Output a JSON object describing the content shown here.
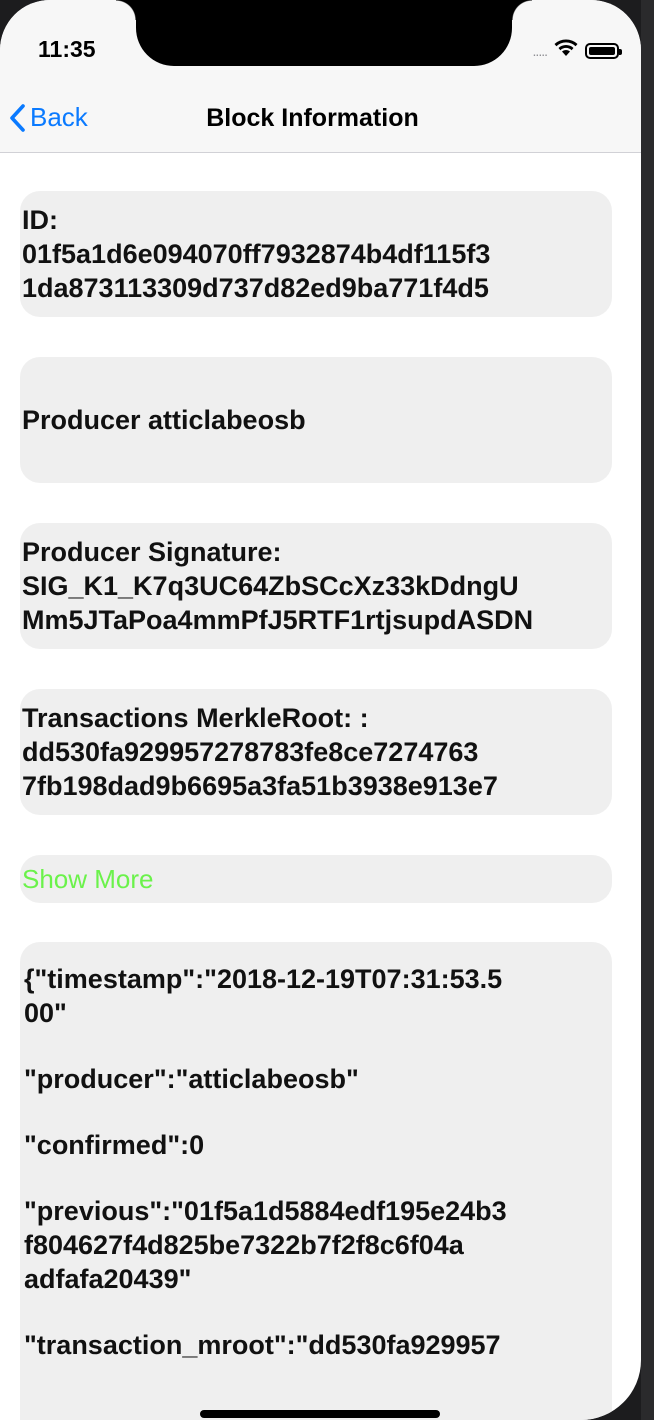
{
  "status_bar": {
    "time": "11:35",
    "signal": "....."
  },
  "nav": {
    "back_label": "Back",
    "title": "Block Information"
  },
  "cards": {
    "id": {
      "lines": [
        "ID:",
        "01f5a1d6e094070ff7932874b4df115f3",
        "1da873113309d737d82ed9ba771f4d5"
      ]
    },
    "producer": {
      "text": "Producer atticlabeosb"
    },
    "signature": {
      "lines": [
        "Producer Signature:",
        "SIG_K1_K7q3UC64ZbSCcXz33kDdngU",
        "Mm5JTaPoa4mmPfJ5RTF1rtjsupdASDN"
      ]
    },
    "merkle": {
      "lines": [
        "Transactions MerkleRoot: :",
        "dd530fa929957278783fe8ce7274763",
        "7fb198dad9b6695a3fa51b3938e913e7"
      ]
    },
    "show_more": "Show More"
  },
  "json_block": {
    "timestamp": [
      "{\"timestamp\":\"2018-12-19T07:31:53.5",
      "00\""
    ],
    "producer": [
      "\"producer\":\"atticlabeosb\""
    ],
    "confirmed": [
      "\"confirmed\":0"
    ],
    "previous": [
      "\"previous\":\"01f5a1d5884edf195e24b3",
      "f804627f4d825be7322b7f2f8c6f04a",
      "adfafa20439\""
    ],
    "transaction_mroot": [
      "\"transaction_mroot\":\"dd530fa929957"
    ]
  },
  "colors": {
    "accent_blue": "#0a7aff",
    "show_more_green": "#6bf24b",
    "card_bg": "#efefef"
  }
}
